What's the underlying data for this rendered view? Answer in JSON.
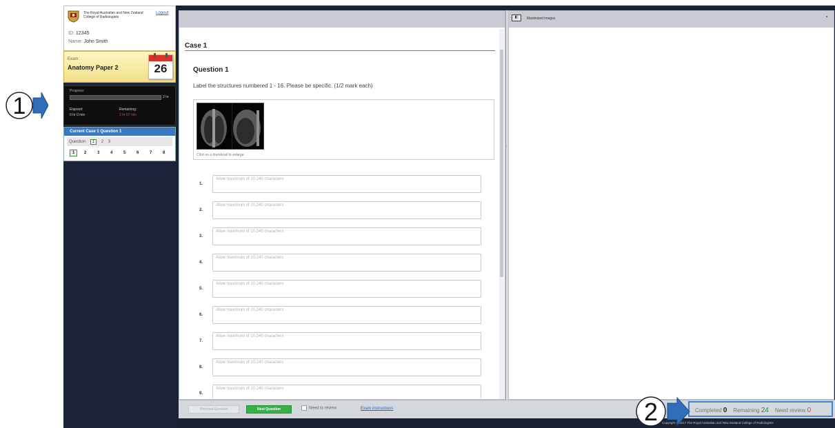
{
  "sidebar": {
    "college_name": "The Royal Australian and New Zealand College of Radiologists",
    "logout_label": "Logout",
    "id_label": "ID:",
    "id_value": "12345",
    "name_label": "Name:",
    "name_value": "John Smith",
    "exam_label": "Exam:",
    "exam_name": "Anatomy Paper 2",
    "calendar_day": "26",
    "progress_label": "Progress:",
    "progress_fraction": 0,
    "progress_total": "2 hr",
    "elapsed_label": "Elapsed:",
    "elapsed_value": "0 hr 0 min",
    "remaining_label": "Remaining:",
    "remaining_value": "1 hr 57 min",
    "current_label": "Current Case 1 Question 1",
    "question_label": "Question",
    "question_numbers": [
      "1",
      "2",
      "3"
    ],
    "item_numbers": [
      "1",
      "2",
      "3",
      "4",
      "5",
      "6",
      "7",
      "8"
    ]
  },
  "annotations": {
    "callout_1": "1",
    "callout_2": "2"
  },
  "main": {
    "case_title": "Case 1",
    "question_title": "Question 1",
    "question_text": "Label the structures numbered 1 - 16. Please be specific. (1/2 mark each)",
    "thumbnail_caption": "Click on a thumbnail to enlarge",
    "answer_placeholder": "Allow maximum of 10,240 characters",
    "answer_numbers": [
      "1.",
      "2.",
      "3.",
      "4.",
      "5.",
      "6.",
      "7.",
      "8.",
      "9."
    ]
  },
  "right_panel": {
    "title": "Maximized images"
  },
  "footer": {
    "previous_label": "Previous Question",
    "next_label": "Next Question",
    "need_review_label": "Need to review",
    "instructions_label": "Exam instructions",
    "completed_label": "Completed",
    "completed_value": "0",
    "remaining_label": "Remaining",
    "remaining_value": "24",
    "need_review_count_label": "Need review",
    "need_review_value": "0",
    "copyright": "Copyright © 2017 The Royal Australian and New Zealand College of Radiologists"
  },
  "colors": {
    "sidebar_bg": "#1c2439",
    "next_button": "#36b14a",
    "callout_blue": "#2f6fb9",
    "header_blue": "#3b77c1"
  }
}
